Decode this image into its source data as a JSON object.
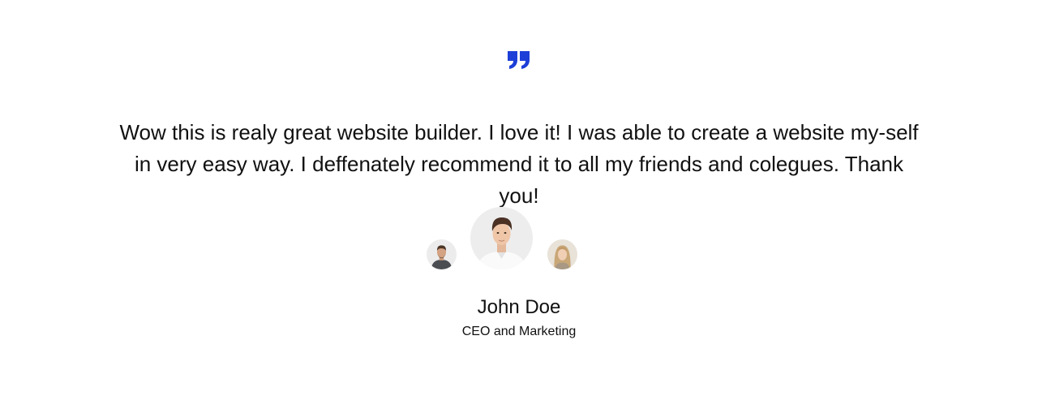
{
  "testimonial": {
    "quote": "Wow this is realy great website builder. I love it! I was able to create a website my-self in very easy way. I deffenately recommend it to all my friends and colegues. Thank you!",
    "author": {
      "name": "John Doe",
      "role": "CEO and Marketing"
    },
    "accent_color": "#1d3fd8",
    "icon": "quote-icon",
    "avatars": [
      {
        "position": "left",
        "active": false,
        "icon": "avatar-man-dark-shirt"
      },
      {
        "position": "center",
        "active": true,
        "icon": "avatar-man-white-shirt"
      },
      {
        "position": "right",
        "active": false,
        "icon": "avatar-woman-blonde"
      }
    ]
  }
}
